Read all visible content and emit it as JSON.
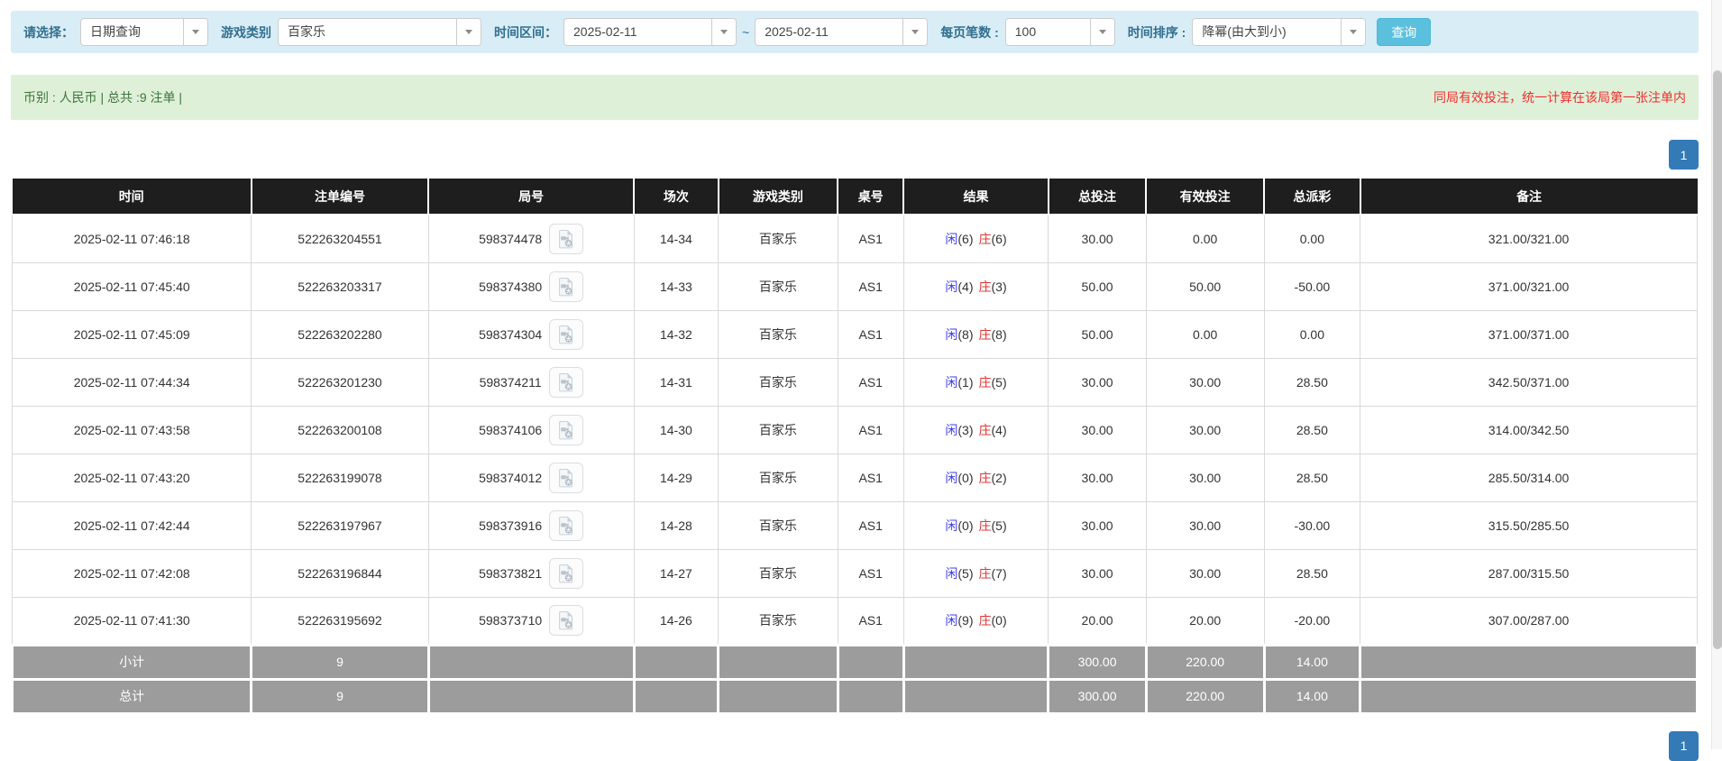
{
  "filters": {
    "select_label": "请选择：",
    "select_value": "日期查询",
    "game_category_label": "游戏类别",
    "game_category_value": "百家乐",
    "time_range_label": "时间区间：",
    "date_from": "2025-02-11",
    "range_separator": "~",
    "date_to": "2025-02-11",
    "page_size_label": "每页笔数 :",
    "page_size_value": "100",
    "sort_label": "时间排序 :",
    "sort_value": "降幂(由大到小)",
    "search_button": "查询"
  },
  "summary": {
    "left_text": "币别 : 人民币 | 总共 :9 注单 |",
    "right_notice": "同局有效投注，统一计算在该局第一张注单内"
  },
  "pagination": {
    "page": "1"
  },
  "table": {
    "headers": [
      "时间",
      "注单编号",
      "局号",
      "场次",
      "游戏类别",
      "桌号",
      "结果",
      "总投注",
      "有效投注",
      "总派彩",
      "备注"
    ],
    "rows": [
      {
        "time": "2025-02-11 07:46:18",
        "bet_id": "522263204551",
        "round_id": "598374478",
        "session": "14-34",
        "game": "百家乐",
        "table_code": "AS1",
        "result_player": "闲(6)",
        "result_banker": "庄(6)",
        "total_bet": "30.00",
        "valid_bet": "0.00",
        "payout": "0.00",
        "remark": "321.00/321.00"
      },
      {
        "time": "2025-02-11 07:45:40",
        "bet_id": "522263203317",
        "round_id": "598374380",
        "session": "14-33",
        "game": "百家乐",
        "table_code": "AS1",
        "result_player": "闲(4)",
        "result_banker": "庄(3)",
        "total_bet": "50.00",
        "valid_bet": "50.00",
        "payout": "-50.00",
        "remark": "371.00/321.00"
      },
      {
        "time": "2025-02-11 07:45:09",
        "bet_id": "522263202280",
        "round_id": "598374304",
        "session": "14-32",
        "game": "百家乐",
        "table_code": "AS1",
        "result_player": "闲(8)",
        "result_banker": "庄(8)",
        "total_bet": "50.00",
        "valid_bet": "0.00",
        "payout": "0.00",
        "remark": "371.00/371.00"
      },
      {
        "time": "2025-02-11 07:44:34",
        "bet_id": "522263201230",
        "round_id": "598374211",
        "session": "14-31",
        "game": "百家乐",
        "table_code": "AS1",
        "result_player": "闲(1)",
        "result_banker": "庄(5)",
        "total_bet": "30.00",
        "valid_bet": "30.00",
        "payout": "28.50",
        "remark": "342.50/371.00"
      },
      {
        "time": "2025-02-11 07:43:58",
        "bet_id": "522263200108",
        "round_id": "598374106",
        "session": "14-30",
        "game": "百家乐",
        "table_code": "AS1",
        "result_player": "闲(3)",
        "result_banker": "庄(4)",
        "total_bet": "30.00",
        "valid_bet": "30.00",
        "payout": "28.50",
        "remark": "314.00/342.50"
      },
      {
        "time": "2025-02-11 07:43:20",
        "bet_id": "522263199078",
        "round_id": "598374012",
        "session": "14-29",
        "game": "百家乐",
        "table_code": "AS1",
        "result_player": "闲(0)",
        "result_banker": "庄(2)",
        "total_bet": "30.00",
        "valid_bet": "30.00",
        "payout": "28.50",
        "remark": "285.50/314.00"
      },
      {
        "time": "2025-02-11 07:42:44",
        "bet_id": "522263197967",
        "round_id": "598373916",
        "session": "14-28",
        "game": "百家乐",
        "table_code": "AS1",
        "result_player": "闲(0)",
        "result_banker": "庄(5)",
        "total_bet": "30.00",
        "valid_bet": "30.00",
        "payout": "-30.00",
        "remark": "315.50/285.50"
      },
      {
        "time": "2025-02-11 07:42:08",
        "bet_id": "522263196844",
        "round_id": "598373821",
        "session": "14-27",
        "game": "百家乐",
        "table_code": "AS1",
        "result_player": "闲(5)",
        "result_banker": "庄(7)",
        "total_bet": "30.00",
        "valid_bet": "30.00",
        "payout": "28.50",
        "remark": "287.00/315.50"
      },
      {
        "time": "2025-02-11 07:41:30",
        "bet_id": "522263195692",
        "round_id": "598373710",
        "session": "14-26",
        "game": "百家乐",
        "table_code": "AS1",
        "result_player": "闲(9)",
        "result_banker": "庄(0)",
        "total_bet": "20.00",
        "valid_bet": "20.00",
        "payout": "-20.00",
        "remark": "307.00/287.00"
      }
    ],
    "subtotal": {
      "label": "小计",
      "count": "9",
      "total_bet": "300.00",
      "valid_bet": "220.00",
      "payout": "14.00"
    },
    "total": {
      "label": "总计",
      "count": "9",
      "total_bet": "300.00",
      "valid_bet": "220.00",
      "payout": "14.00"
    }
  },
  "colors": {
    "filter_bar_bg": "#d9edf7",
    "filter_label": "#31708f",
    "search_button_bg": "#5bc0de",
    "summary_bg": "#dff0d8",
    "summary_text": "#3c763d",
    "notice_red": "#f12e2e",
    "pagination_blue": "#337ab7",
    "header_bg": "#1e1e1e",
    "totals_bg": "#9c9c9c",
    "bet_blue": "#2d6ce2",
    "negative_red": "#e8332e",
    "player_blue": "#3e3ef2",
    "banker_red": "#e03434"
  }
}
